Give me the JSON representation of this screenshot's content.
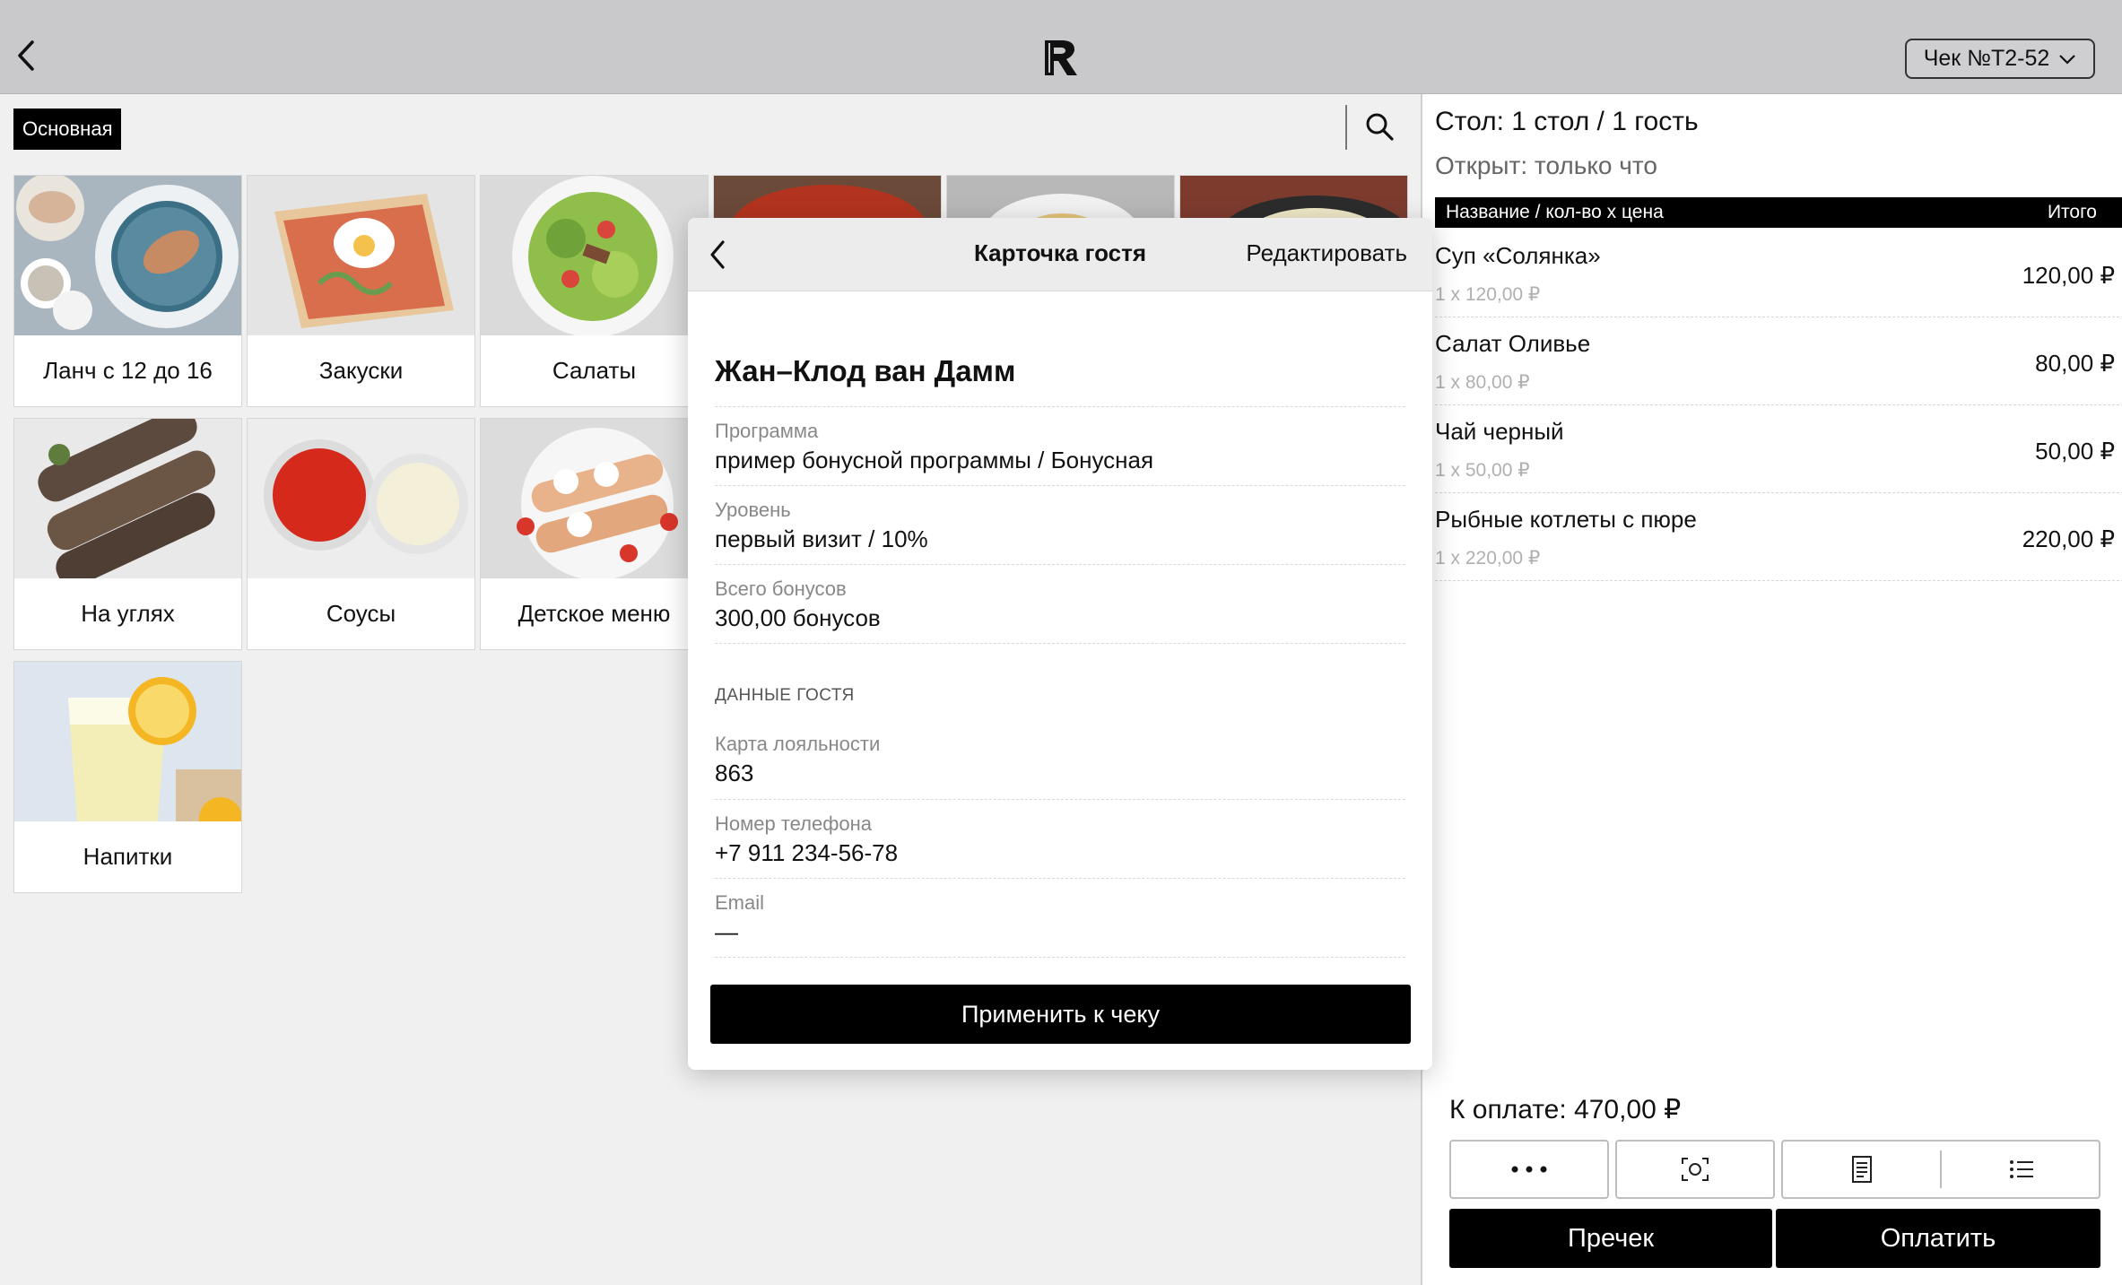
{
  "header": {
    "logo_letter": "R",
    "check_label": "Чек №T2-52"
  },
  "menu": {
    "active_category": "Основная",
    "tiles": [
      {
        "label": "Ланч с 12 до 16"
      },
      {
        "label": "Закуски"
      },
      {
        "label": "Салаты"
      },
      {
        "label": "На углях"
      },
      {
        "label": "Соусы"
      },
      {
        "label": "Детское меню"
      },
      {
        "label": "Напитки"
      }
    ]
  },
  "order": {
    "table_info": "Стол: 1 стол / 1 гость",
    "opened_info": "Открыт: только что",
    "col_name": "Название / кол-во х цена",
    "col_total": "Итого",
    "items": [
      {
        "name": "Суп «Солянка»",
        "qty": "1 x 120,00 ₽",
        "total": "120,00 ₽"
      },
      {
        "name": "Салат Оливье",
        "qty": "1 x 80,00 ₽",
        "total": "80,00 ₽"
      },
      {
        "name": "Чай черный",
        "qty": "1 x 50,00 ₽",
        "total": "50,00 ₽"
      },
      {
        "name": "Рыбные котлеты с пюре",
        "qty": "1 x 220,00 ₽",
        "total": "220,00 ₽"
      }
    ],
    "to_pay": "К оплате: 470,00 ₽",
    "precheck_label": "Пречек",
    "pay_label": "Оплатить"
  },
  "guest_card": {
    "title": "Карточка гостя",
    "edit_label": "Редактировать",
    "guest_name": "Жан–Клод ван Дамм",
    "program_key": "Программа",
    "program_value": "пример бонусной программы / Бонусная",
    "level_key": "Уровень",
    "level_value": "первый визит / 10%",
    "bonus_key": "Всего бонусов",
    "bonus_value": "300,00 бонусов",
    "section_title": "ДАННЫЕ ГОСТЯ",
    "card_key": "Карта лояльности",
    "card_value": "863",
    "phone_key": "Номер телефона",
    "phone_value": "+7 911 234-56-78",
    "email_key": "Email",
    "email_value": "—",
    "apply_label": "Применить к чеку"
  }
}
